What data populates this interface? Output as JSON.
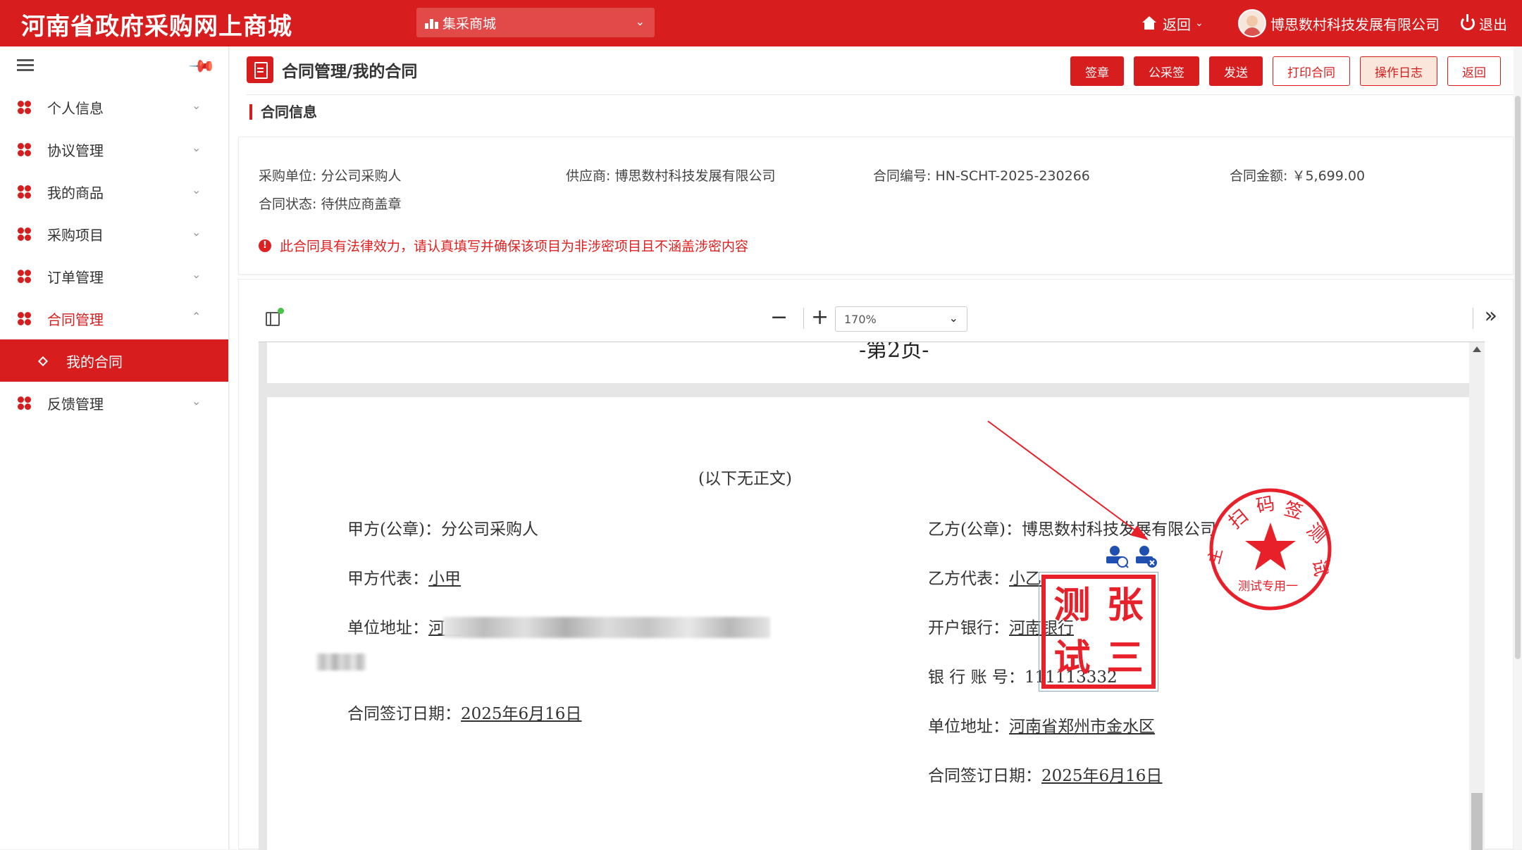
{
  "app": {
    "title": "河南省政府采购网上商城",
    "system_select": "集采商城",
    "back_label": "返回",
    "company_name": "博思数村科技发展有限公司",
    "logout_label": "退出"
  },
  "colors": {
    "primary": "#d71d1d",
    "warning": "#e02020",
    "seal": "#e8202a"
  },
  "sidebar": {
    "items": [
      {
        "label": "个人信息"
      },
      {
        "label": "协议管理"
      },
      {
        "label": "我的商品"
      },
      {
        "label": "采购项目"
      },
      {
        "label": "订单管理"
      },
      {
        "label": "合同管理",
        "expanded": true
      },
      {
        "label": "反馈管理"
      }
    ],
    "sub_item": "我的合同"
  },
  "page": {
    "title": "合同管理/我的合同",
    "section": "合同信息",
    "buttons": {
      "sign": "签章",
      "official_sign": "公采签",
      "send": "发送",
      "print": "打印合同",
      "log": "操作日志",
      "back": "返回"
    }
  },
  "contract": {
    "buyer": "采购单位: 分公司采购人",
    "supplier": "供应商: 博思数村科技发展有限公司",
    "number": "合同编号: HN-SCHT-2025-230266",
    "amount": "合同金额: ￥5,699.00",
    "status": "合同状态: 待供应商盖章",
    "warning": "此合同具有法律效力，请认真填写并确保该项目为非涉密项目且不涵盖涉密内容"
  },
  "viewer": {
    "zoom": "170%",
    "page_label": "-第2页-",
    "end_note": "(以下无正文)",
    "party_a": {
      "seal_label": "甲方(公章)：分公司采购人",
      "rep_label": "甲方代表：",
      "rep": "小甲",
      "addr_label": "单位地址：",
      "addr_visible": "河南",
      "date_label": "合同签订日期：",
      "date": "2025年6月16日"
    },
    "party_b": {
      "seal_label": "乙方(公章)：博思数村科技发展有限公司",
      "rep_label": "乙方代表：",
      "rep": "小乙",
      "bank_label": "开户银行：",
      "bank": "河南银行",
      "account_label": "银 行 账 号：",
      "account": "111113332",
      "addr_label": "单位地址：",
      "addr": "河南省郑州市金水区",
      "date_label": "合同签订日期：",
      "date": "2025年6月16日"
    },
    "square_seal_chars": [
      "测",
      "张",
      "试",
      "三"
    ],
    "round_seal_text": "扫码签测试专用一"
  }
}
